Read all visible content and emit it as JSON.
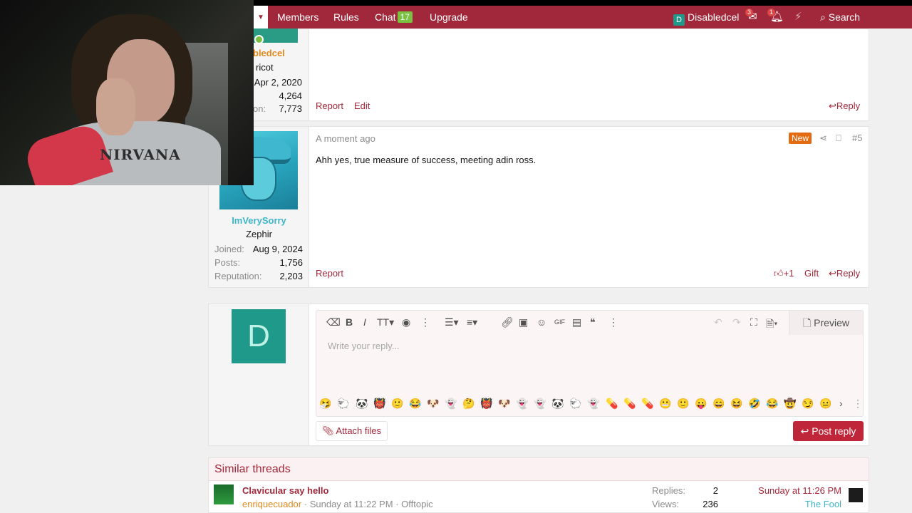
{
  "nav": {
    "items": [
      "Members",
      "Rules",
      "Chat",
      "Upgrade"
    ],
    "chat_badge": "17",
    "user_initial": "D",
    "username": "Disabledcel",
    "inbox_count": "3",
    "alerts_count": "1",
    "search": "Search",
    "dropdown_icon": "chevron-down-icon"
  },
  "post1": {
    "username_partial": "bledcel",
    "title_partial": "ricot",
    "joined_value": "Apr 2, 2020",
    "posts_value": "4,264",
    "rep_label_partial": "on:",
    "rep_value": "7,773",
    "actions": {
      "report": "Report",
      "edit": "Edit",
      "reply": "Reply"
    }
  },
  "post2": {
    "time": "A moment ago",
    "new_badge": "New",
    "number": "#5",
    "body": "Ahh yes, true measure of success, meeting adin ross.",
    "username": "ImVerySorry",
    "title": "Zephir",
    "joined_label": "Joined:",
    "joined_value": "Aug 9, 2024",
    "posts_label": "Posts:",
    "posts_value": "1,756",
    "rep_label": "Reputation:",
    "rep_value": "2,203",
    "actions": {
      "report": "Report",
      "like": "+1",
      "gift": "Gift",
      "reply": "Reply"
    }
  },
  "editor": {
    "avatar_initial": "D",
    "placeholder": "Write your reply...",
    "preview": "Preview",
    "attach": "Attach files",
    "post_reply": "Post reply",
    "emojis": [
      "🤧",
      "🐑",
      "🐼",
      "👹",
      "🙂",
      "😂",
      "🐶",
      "👻",
      "🤔",
      "👹",
      "🐶",
      "👻",
      "👻",
      "🐼",
      "🐑",
      "👻",
      "💊",
      "💊",
      "💊",
      "😬",
      "🙂",
      "😛",
      "😄",
      "😆",
      "🤣",
      "😂",
      "🤠",
      "😏",
      "😐"
    ]
  },
  "similar": {
    "heading": "Similar threads",
    "thread_title": "Clavicular say hello",
    "author": "enriquecuador",
    "date": "Sunday at 11:22 PM",
    "forum": "Offtopic",
    "replies_label": "Replies:",
    "replies_value": "2",
    "views_label": "Views:",
    "views_value": "236",
    "last_date": "Sunday at 11:26 PM",
    "last_user": "The Fool"
  },
  "webcam": {
    "shirt_text": "NIRVANA"
  },
  "colors": {
    "brand": "#a1283a",
    "new_badge": "#e36c12",
    "avatar_teal": "#1f9a8a"
  }
}
